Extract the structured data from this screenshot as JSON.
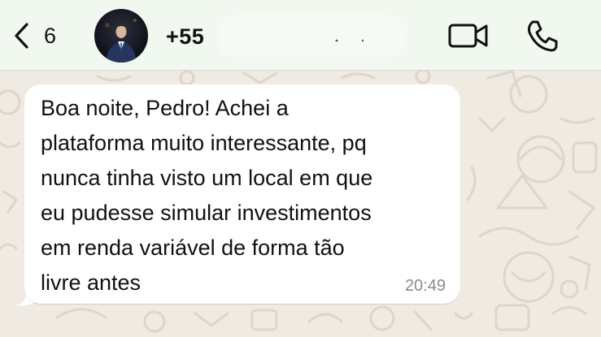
{
  "colors": {
    "header_bg": "#f1f8ef",
    "chat_bg": "#efeae2",
    "bubble_bg": "#ffffff",
    "timestamp": "#8a8a8a",
    "icon": "#111111"
  },
  "header": {
    "back_icon": "chevron-left-icon",
    "back_count": "6",
    "avatar_icon": "contact-avatar",
    "contact_name": "+55",
    "video_call_icon": "video-camera-icon",
    "voice_call_icon": "phone-icon"
  },
  "messages": [
    {
      "direction": "incoming",
      "text": "Boa noite, Pedro! Achei a\nplataforma muito interessante, pq\nnunca tinha visto um local em que\neu pudesse simular investimentos\nem renda variável de forma tão\nlivre antes",
      "time": "20:49"
    }
  ]
}
